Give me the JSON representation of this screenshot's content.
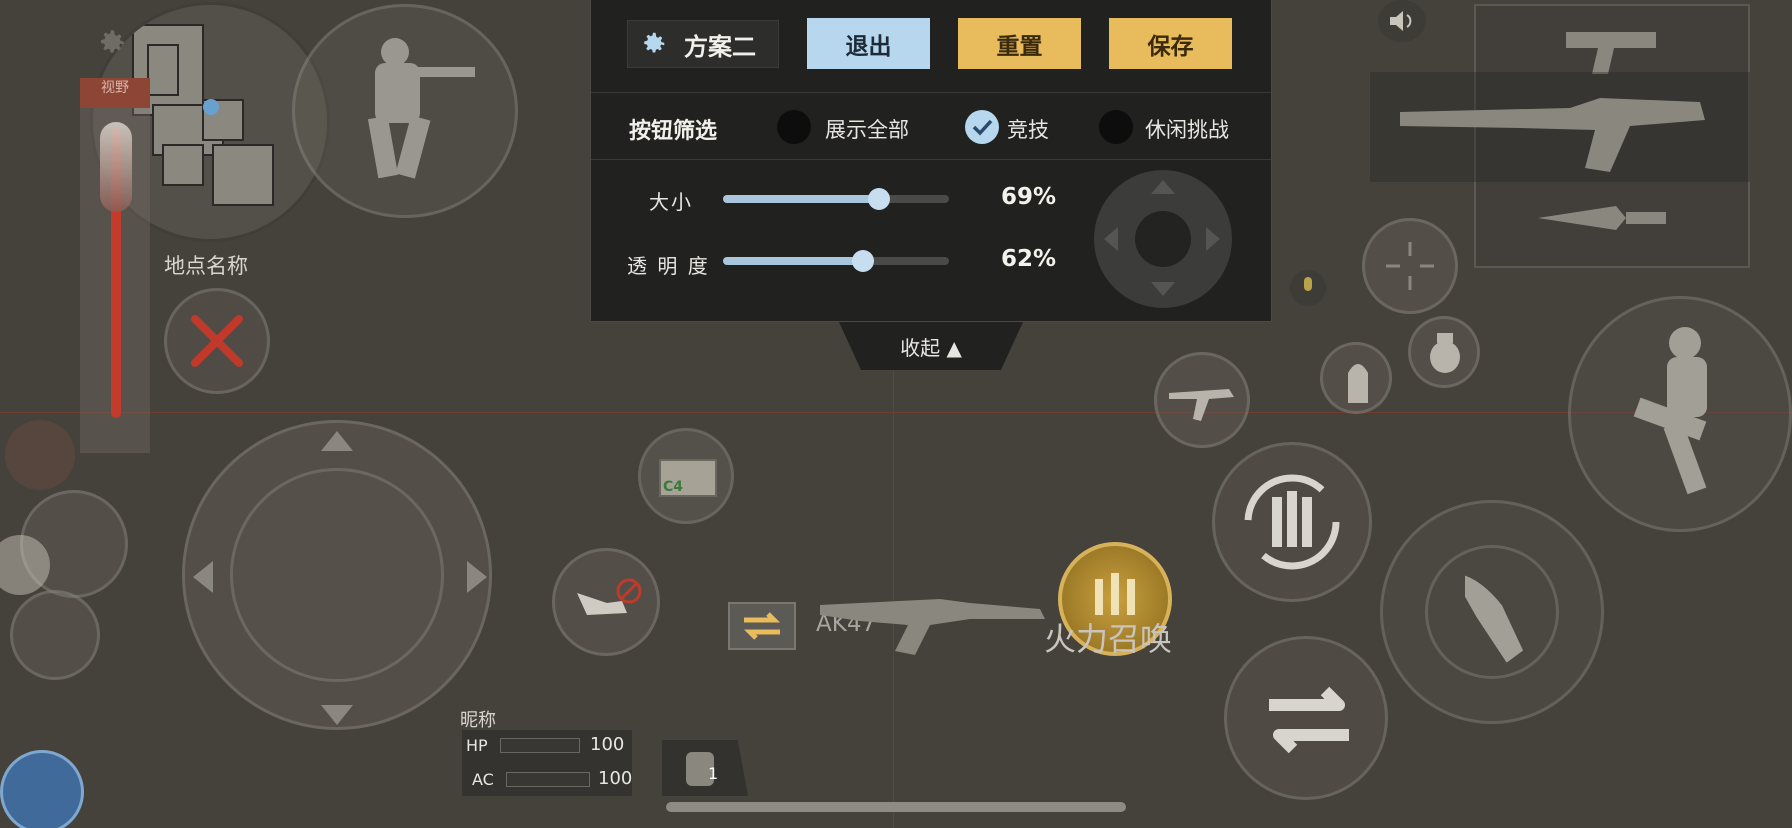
{
  "panel": {
    "scheme_name": "方案二",
    "exit_label": "退出",
    "reset_label": "重置",
    "save_label": "保存",
    "filter_title": "按钮筛选",
    "filters": [
      {
        "label": "展示全部",
        "checked": false
      },
      {
        "label": "竞技",
        "checked": true
      },
      {
        "label": "休闲挑战",
        "checked": false
      }
    ],
    "size_label": "大小",
    "size_value": 0.69,
    "size_text": "69%",
    "opacity_label": "透 明 度",
    "opacity_value": 0.62,
    "opacity_text": "62%",
    "collapse_label": "收起 ▲"
  },
  "hud": {
    "map_label": "视野",
    "location_name": "地点名称",
    "weapon_name": "AK47",
    "fire_support": "火力召唤",
    "nickname": "昵称",
    "hp_label": "HP",
    "hp_value": "100",
    "ac_label": "AC",
    "ac_value": "100",
    "backpack_count": "1",
    "c4_label": "C4"
  },
  "colors": {
    "accent_blue": "#b7d7ef",
    "accent_gold": "#e8bb5c",
    "cancel_red": "#c0392b",
    "background": "#45413b"
  },
  "icons": [
    "gear-icon",
    "soldier-aim-icon",
    "minimap",
    "close-icon",
    "joystick",
    "kick-icon",
    "swap-icon",
    "ak47-icon",
    "fire-support-icon",
    "c4-icon",
    "crouch-jump-icon",
    "reload-icon",
    "switch-icon",
    "bullet-icon",
    "grenade-icon",
    "scope-icon",
    "mic-icon",
    "speaker-icon",
    "pistol-icon",
    "rifle-icon",
    "knife-icon",
    "backpack-icon"
  ]
}
